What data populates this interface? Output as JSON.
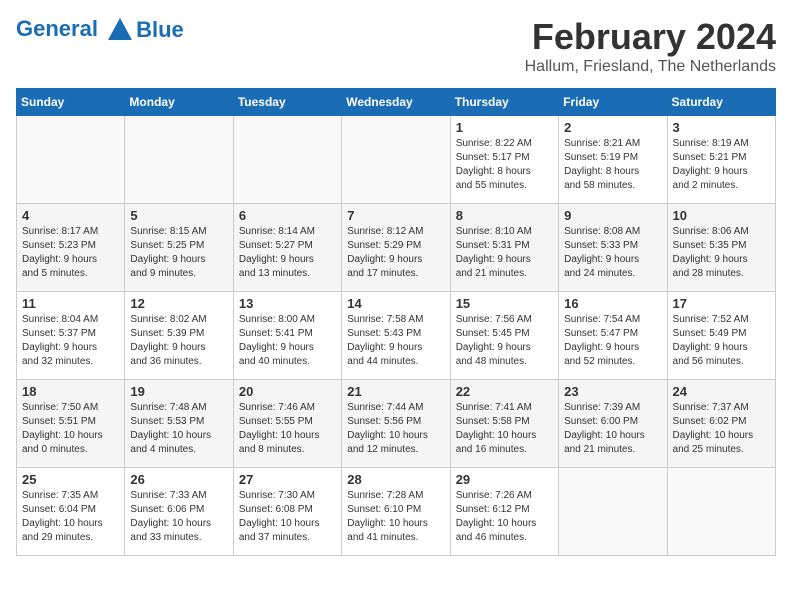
{
  "header": {
    "logo_line1": "General",
    "logo_line2": "Blue",
    "month": "February 2024",
    "location": "Hallum, Friesland, The Netherlands"
  },
  "weekdays": [
    "Sunday",
    "Monday",
    "Tuesday",
    "Wednesday",
    "Thursday",
    "Friday",
    "Saturday"
  ],
  "weeks": [
    [
      {
        "day": "",
        "info": ""
      },
      {
        "day": "",
        "info": ""
      },
      {
        "day": "",
        "info": ""
      },
      {
        "day": "",
        "info": ""
      },
      {
        "day": "1",
        "info": "Sunrise: 8:22 AM\nSunset: 5:17 PM\nDaylight: 8 hours\nand 55 minutes."
      },
      {
        "day": "2",
        "info": "Sunrise: 8:21 AM\nSunset: 5:19 PM\nDaylight: 8 hours\nand 58 minutes."
      },
      {
        "day": "3",
        "info": "Sunrise: 8:19 AM\nSunset: 5:21 PM\nDaylight: 9 hours\nand 2 minutes."
      }
    ],
    [
      {
        "day": "4",
        "info": "Sunrise: 8:17 AM\nSunset: 5:23 PM\nDaylight: 9 hours\nand 5 minutes."
      },
      {
        "day": "5",
        "info": "Sunrise: 8:15 AM\nSunset: 5:25 PM\nDaylight: 9 hours\nand 9 minutes."
      },
      {
        "day": "6",
        "info": "Sunrise: 8:14 AM\nSunset: 5:27 PM\nDaylight: 9 hours\nand 13 minutes."
      },
      {
        "day": "7",
        "info": "Sunrise: 8:12 AM\nSunset: 5:29 PM\nDaylight: 9 hours\nand 17 minutes."
      },
      {
        "day": "8",
        "info": "Sunrise: 8:10 AM\nSunset: 5:31 PM\nDaylight: 9 hours\nand 21 minutes."
      },
      {
        "day": "9",
        "info": "Sunrise: 8:08 AM\nSunset: 5:33 PM\nDaylight: 9 hours\nand 24 minutes."
      },
      {
        "day": "10",
        "info": "Sunrise: 8:06 AM\nSunset: 5:35 PM\nDaylight: 9 hours\nand 28 minutes."
      }
    ],
    [
      {
        "day": "11",
        "info": "Sunrise: 8:04 AM\nSunset: 5:37 PM\nDaylight: 9 hours\nand 32 minutes."
      },
      {
        "day": "12",
        "info": "Sunrise: 8:02 AM\nSunset: 5:39 PM\nDaylight: 9 hours\nand 36 minutes."
      },
      {
        "day": "13",
        "info": "Sunrise: 8:00 AM\nSunset: 5:41 PM\nDaylight: 9 hours\nand 40 minutes."
      },
      {
        "day": "14",
        "info": "Sunrise: 7:58 AM\nSunset: 5:43 PM\nDaylight: 9 hours\nand 44 minutes."
      },
      {
        "day": "15",
        "info": "Sunrise: 7:56 AM\nSunset: 5:45 PM\nDaylight: 9 hours\nand 48 minutes."
      },
      {
        "day": "16",
        "info": "Sunrise: 7:54 AM\nSunset: 5:47 PM\nDaylight: 9 hours\nand 52 minutes."
      },
      {
        "day": "17",
        "info": "Sunrise: 7:52 AM\nSunset: 5:49 PM\nDaylight: 9 hours\nand 56 minutes."
      }
    ],
    [
      {
        "day": "18",
        "info": "Sunrise: 7:50 AM\nSunset: 5:51 PM\nDaylight: 10 hours\nand 0 minutes."
      },
      {
        "day": "19",
        "info": "Sunrise: 7:48 AM\nSunset: 5:53 PM\nDaylight: 10 hours\nand 4 minutes."
      },
      {
        "day": "20",
        "info": "Sunrise: 7:46 AM\nSunset: 5:55 PM\nDaylight: 10 hours\nand 8 minutes."
      },
      {
        "day": "21",
        "info": "Sunrise: 7:44 AM\nSunset: 5:56 PM\nDaylight: 10 hours\nand 12 minutes."
      },
      {
        "day": "22",
        "info": "Sunrise: 7:41 AM\nSunset: 5:58 PM\nDaylight: 10 hours\nand 16 minutes."
      },
      {
        "day": "23",
        "info": "Sunrise: 7:39 AM\nSunset: 6:00 PM\nDaylight: 10 hours\nand 21 minutes."
      },
      {
        "day": "24",
        "info": "Sunrise: 7:37 AM\nSunset: 6:02 PM\nDaylight: 10 hours\nand 25 minutes."
      }
    ],
    [
      {
        "day": "25",
        "info": "Sunrise: 7:35 AM\nSunset: 6:04 PM\nDaylight: 10 hours\nand 29 minutes."
      },
      {
        "day": "26",
        "info": "Sunrise: 7:33 AM\nSunset: 6:06 PM\nDaylight: 10 hours\nand 33 minutes."
      },
      {
        "day": "27",
        "info": "Sunrise: 7:30 AM\nSunset: 6:08 PM\nDaylight: 10 hours\nand 37 minutes."
      },
      {
        "day": "28",
        "info": "Sunrise: 7:28 AM\nSunset: 6:10 PM\nDaylight: 10 hours\nand 41 minutes."
      },
      {
        "day": "29",
        "info": "Sunrise: 7:26 AM\nSunset: 6:12 PM\nDaylight: 10 hours\nand 46 minutes."
      },
      {
        "day": "",
        "info": ""
      },
      {
        "day": "",
        "info": ""
      }
    ]
  ]
}
